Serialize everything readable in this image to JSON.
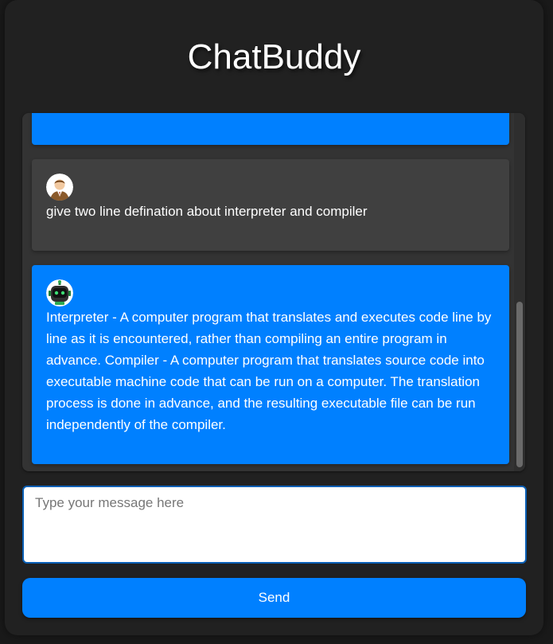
{
  "app": {
    "title": "ChatBuddy"
  },
  "messages": [
    {
      "sender": "bot",
      "avatar_icon": "robot-avatar-icon",
      "text": ""
    },
    {
      "sender": "user",
      "avatar_icon": "user-avatar-icon",
      "text": "give two line defination about interpreter and compiler"
    },
    {
      "sender": "bot",
      "avatar_icon": "robot-avatar-icon",
      "text": "Interpreter - A computer program that translates and executes code line by line as it is encountered, rather than compiling an entire program in advance. Compiler - A computer program that translates source code into executable machine code that can be run on a computer. The translation process is done in advance, and the resulting executable file can be run independently of the compiler."
    }
  ],
  "input": {
    "placeholder": "Type your message here",
    "value": ""
  },
  "send_button": {
    "label": "Send"
  },
  "colors": {
    "background": "#1a1a1a",
    "panel": "#212121",
    "chat_window": "#333333",
    "bot_message": "#0080ff",
    "user_message": "#404040",
    "accent": "#0080ff"
  }
}
